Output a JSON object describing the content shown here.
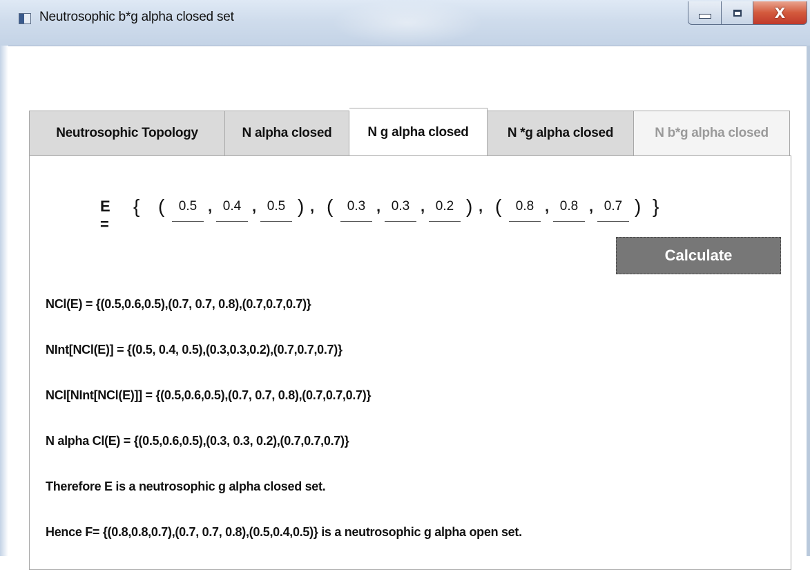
{
  "window": {
    "title": "Neutrosophic b*g alpha closed set",
    "close_glyph": "X"
  },
  "tabs": [
    {
      "label": "Neutrosophic Topology",
      "state": "normal"
    },
    {
      "label": "N alpha closed",
      "state": "normal"
    },
    {
      "label": "N g alpha closed",
      "state": "selected"
    },
    {
      "label": "N *g alpha closed",
      "state": "normal"
    },
    {
      "label": "N b*g alpha closed",
      "state": "disabled"
    }
  ],
  "equation": {
    "label": "E =",
    "open_brace": "{",
    "close_brace": "}",
    "open_paren": "(",
    "close_paren": ")",
    "comma": ",",
    "triples": [
      [
        "0.5",
        "0.4",
        "0.5"
      ],
      [
        "0.3",
        "0.3",
        "0.2"
      ],
      [
        "0.8",
        "0.8",
        "0.7"
      ]
    ]
  },
  "calculate_label": "Calculate",
  "results": [
    "NCl(E) = {(0.5,0.6,0.5),(0.7, 0.7, 0.8),(0.7,0.7,0.7)}",
    "NInt[NCl(E)] = {(0.5, 0.4, 0.5),(0.3,0.3,0.2),(0.7,0.7,0.7)}",
    "NCl[NInt[NCl(E)]] = {(0.5,0.6,0.5),(0.7, 0.7, 0.8),(0.7,0.7,0.7)}",
    "N alpha Cl(E) = {(0.5,0.6,0.5),(0.3, 0.3, 0.2),(0.7,0.7,0.7)}",
    "Therefore E is a neutrosophic g alpha closed set.",
    "Hence F= {(0.8,0.8,0.7),(0.7, 0.7, 0.8),(0.5,0.4,0.5)} is a neutrosophic g alpha open set."
  ],
  "colors": {
    "button_bg": "#777777",
    "tab_inactive": "#dadada",
    "tab_disabled_text": "#9a9a9a",
    "close_button": "#c0392b"
  }
}
